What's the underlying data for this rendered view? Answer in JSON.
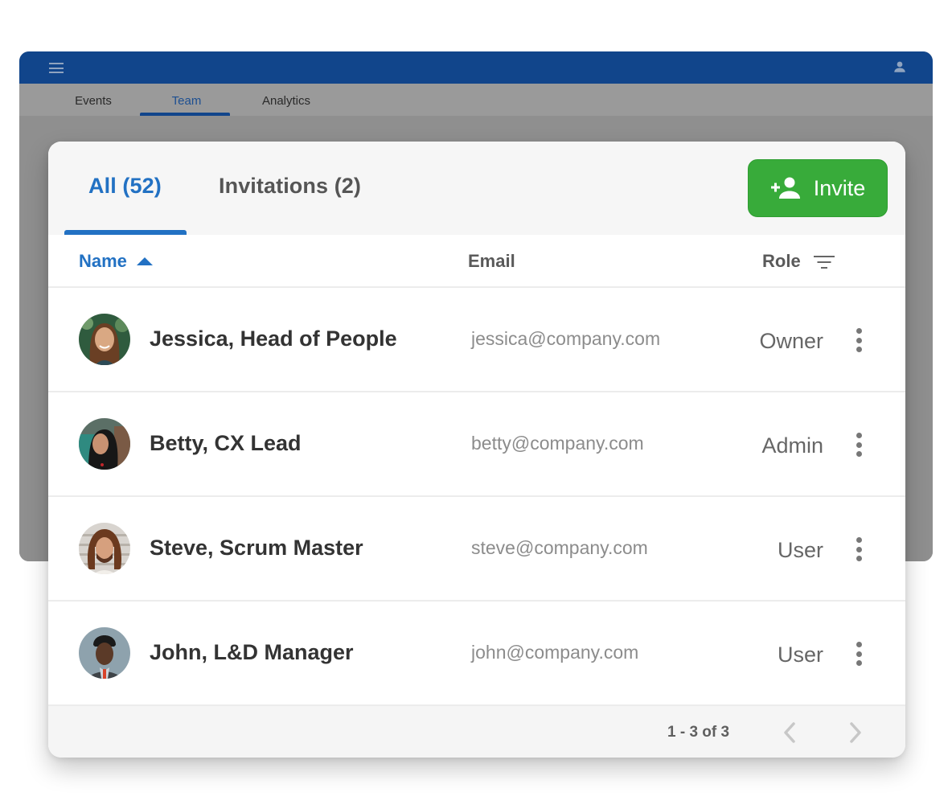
{
  "app": {
    "nav_tabs": [
      {
        "label": "Events",
        "active": false
      },
      {
        "label": "Team",
        "active": true
      },
      {
        "label": "Analytics",
        "active": false
      }
    ],
    "header_color": "#11458b"
  },
  "team_panel": {
    "tabs": [
      {
        "label": "All (52)",
        "active": true
      },
      {
        "label": "Invitations (2)",
        "active": false
      }
    ],
    "invite_button": {
      "label": "Invite",
      "color": "#38ab3a"
    },
    "columns": {
      "name": "Name",
      "email": "Email",
      "role": "Role"
    },
    "sort": {
      "column": "name",
      "direction": "ascending"
    },
    "accent_color": "#2271c3",
    "members": [
      {
        "name": "Jessica, Head of People",
        "email": "jessica@company.com",
        "role": "Owner",
        "avatar": "photo-jessica"
      },
      {
        "name": "Betty, CX Lead",
        "email": "betty@company.com",
        "role": "Admin",
        "avatar": "photo-betty"
      },
      {
        "name": "Steve, Scrum Master",
        "email": "steve@company.com",
        "role": "User",
        "avatar": "photo-steve"
      },
      {
        "name": "John, L&D Manager",
        "email": "john@company.com",
        "role": "User",
        "avatar": "photo-john"
      }
    ],
    "pagination": {
      "label": "1 - 3 of 3",
      "prev_icon": "chevron-left-icon",
      "next_icon": "chevron-right-icon"
    }
  }
}
